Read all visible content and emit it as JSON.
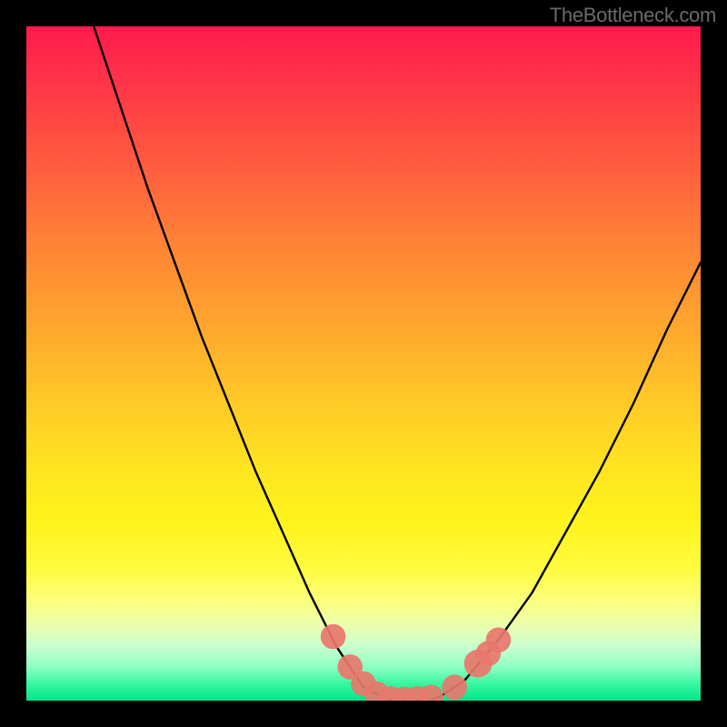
{
  "attribution": "TheBottleneck.com",
  "colors": {
    "frame": "#000000",
    "gradient_top": "#ff1a4d",
    "gradient_mid": "#ffe321",
    "gradient_bottom": "#00e58c",
    "curve": "#000000",
    "markers": "#e8776d"
  },
  "chart_data": {
    "type": "line",
    "title": "",
    "xlabel": "",
    "ylabel": "",
    "xlim": [
      0,
      100
    ],
    "ylim": [
      0,
      100
    ],
    "series": [
      {
        "name": "curve",
        "x": [
          10,
          12,
          15,
          18,
          22,
          26,
          30,
          34,
          38,
          42,
          46,
          50,
          52,
          54,
          56,
          58,
          60,
          62,
          65,
          70,
          75,
          80,
          85,
          90,
          95,
          100
        ],
        "y": [
          100,
          94,
          85,
          76,
          65,
          54,
          44,
          34,
          25,
          16,
          8,
          2,
          1,
          0,
          0,
          0,
          0,
          1,
          3,
          9,
          16,
          25,
          34,
          44,
          55,
          65
        ]
      }
    ],
    "markers": [
      {
        "x": 45.5,
        "y": 9.5,
        "r": 1.2
      },
      {
        "x": 48.0,
        "y": 5.0,
        "r": 1.2
      },
      {
        "x": 50.0,
        "y": 2.5,
        "r": 1.2
      },
      {
        "x": 52.0,
        "y": 1.0,
        "r": 1.2
      },
      {
        "x": 54.0,
        "y": 0.3,
        "r": 1.2
      },
      {
        "x": 56.0,
        "y": 0.2,
        "r": 1.2
      },
      {
        "x": 58.0,
        "y": 0.3,
        "r": 1.2
      },
      {
        "x": 60.0,
        "y": 0.5,
        "r": 1.2
      },
      {
        "x": 63.5,
        "y": 2.0,
        "r": 1.2
      },
      {
        "x": 67.0,
        "y": 5.5,
        "r": 1.4
      },
      {
        "x": 68.5,
        "y": 7.0,
        "r": 1.2
      },
      {
        "x": 70.0,
        "y": 9.0,
        "r": 1.2
      }
    ]
  }
}
